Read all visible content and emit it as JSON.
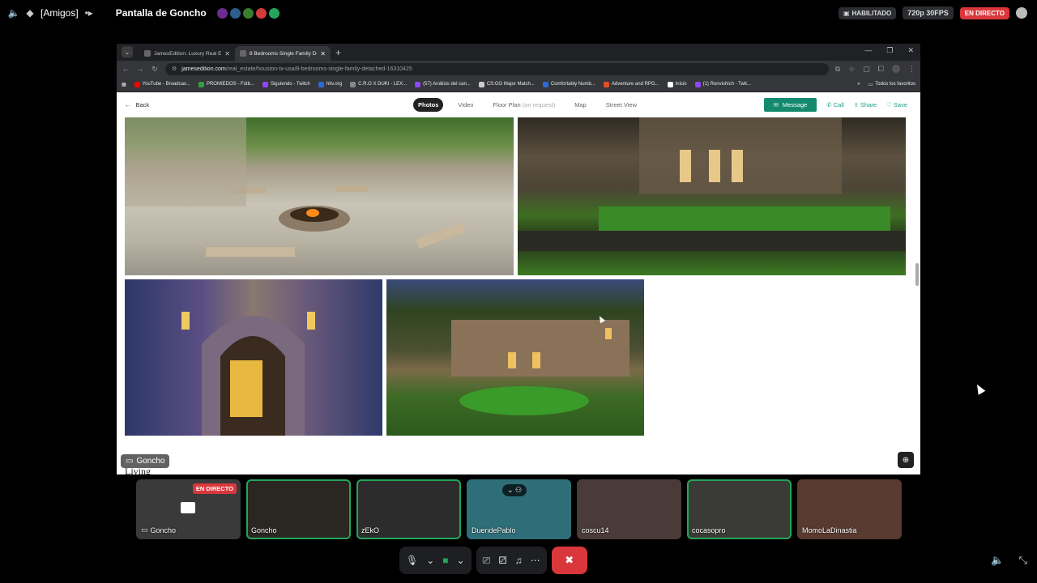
{
  "topbar": {
    "channel": "[Amigos]",
    "stream_title": "Pantalla de Goncho",
    "enabled_label": "HABILITADO",
    "quality_label": "720p 30FPS",
    "live_label": "EN DIRECTO",
    "avatar_colors": [
      "#6b2b8f",
      "#2d5f8a",
      "#3a7d2a",
      "#d33a3a",
      "#23a55a"
    ]
  },
  "browser": {
    "tabs": [
      {
        "label": "JamesEdition: Luxury Real Estat",
        "active": false
      },
      {
        "label": "8 Bedrooms Single Family Deta",
        "active": true
      }
    ],
    "url_domain": "jamesedition.com",
    "url_path": "/real_estate/houston-tx-usa/8-bedrooms-single-family-detached-16310425",
    "bookmarks": [
      {
        "label": "YouTube - Broadcas...",
        "color": "#ff0000"
      },
      {
        "label": "PROMIEDOS - Fútb...",
        "color": "#2ea043"
      },
      {
        "label": "Siguiendo - Twitch",
        "color": "#9146ff"
      },
      {
        "label": "hltv.org",
        "color": "#2d6ad8"
      },
      {
        "label": "C.R.O X DUKI - LEX...",
        "color": "#888888"
      },
      {
        "label": "(57) Análisis del can...",
        "color": "#9146ff"
      },
      {
        "label": "CS:GO Major Match...",
        "color": "#cccccc"
      },
      {
        "label": "Comfortably Numb...",
        "color": "#2d6ad8"
      },
      {
        "label": "Adventure and RPG...",
        "color": "#e44d26"
      },
      {
        "label": "Inicio",
        "color": "#ffffff"
      },
      {
        "label": "(1) Ronvichich - Twit...",
        "color": "#9146ff"
      }
    ],
    "bookmarks_all": "Todos los favoritos"
  },
  "page": {
    "back_label": "Back",
    "tabs": {
      "photos": "Photos",
      "video": "Video",
      "floor_plan": "Floor Plan",
      "floor_plan_note": "(on request)",
      "map": "Map",
      "street_view": "Street View"
    },
    "actions": {
      "message": "Message",
      "call": "Call",
      "share": "Share",
      "save": "Save"
    },
    "stream_owner_tag": "Goncho",
    "section_heading": "Living"
  },
  "participants": [
    {
      "name": "Goncho",
      "live": true,
      "live_label": "EN DIRECTO",
      "color": "#3a3a3a",
      "speaking": false
    },
    {
      "name": "Goncho",
      "color": "#2a2622",
      "speaking": true
    },
    {
      "name": "zEkO",
      "color": "#2c2c2c",
      "speaking": true
    },
    {
      "name": "DuendePablo",
      "color": "#2e6e78",
      "speaking": false
    },
    {
      "name": "coscu14",
      "color": "#4a3a38",
      "speaking": false
    },
    {
      "name": "cocasopro",
      "color": "#3a3a36",
      "speaking": true
    },
    {
      "name": "MomoLaDinastia",
      "color": "#5a3a30",
      "speaking": false
    }
  ]
}
